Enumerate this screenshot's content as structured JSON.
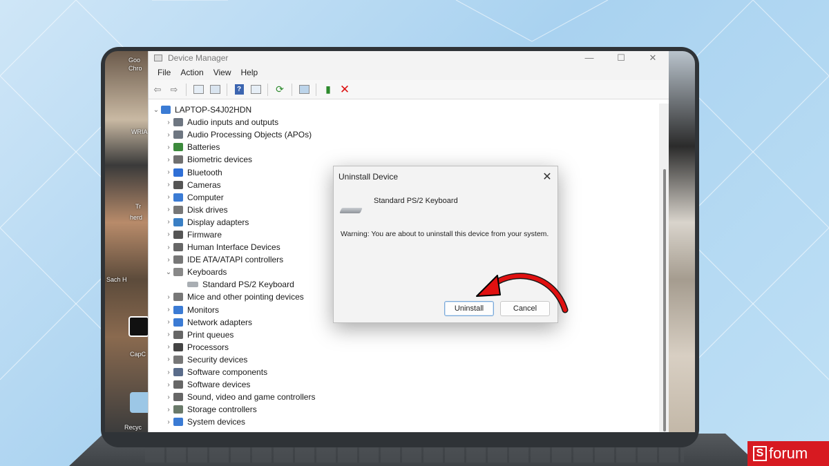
{
  "window": {
    "title": "Device Manager",
    "minimize": "—",
    "maximize": "☐",
    "close": "✕"
  },
  "menu": [
    "File",
    "Action",
    "View",
    "Help"
  ],
  "tree": {
    "root": "LAPTOP-S4J02HDN",
    "items": [
      {
        "label": "Audio inputs and outputs",
        "expanded": false
      },
      {
        "label": "Audio Processing Objects (APOs)",
        "expanded": false
      },
      {
        "label": "Batteries",
        "expanded": false
      },
      {
        "label": "Biometric devices",
        "expanded": false
      },
      {
        "label": "Bluetooth",
        "expanded": false
      },
      {
        "label": "Cameras",
        "expanded": false
      },
      {
        "label": "Computer",
        "expanded": false
      },
      {
        "label": "Disk drives",
        "expanded": false
      },
      {
        "label": "Display adapters",
        "expanded": false
      },
      {
        "label": "Firmware",
        "expanded": false
      },
      {
        "label": "Human Interface Devices",
        "expanded": false
      },
      {
        "label": "IDE ATA/ATAPI controllers",
        "expanded": false
      },
      {
        "label": "Keyboards",
        "expanded": true
      },
      {
        "label": "Standard PS/2 Keyboard",
        "child": true
      },
      {
        "label": "Mice and other pointing devices",
        "expanded": false
      },
      {
        "label": "Monitors",
        "expanded": false
      },
      {
        "label": "Network adapters",
        "expanded": false
      },
      {
        "label": "Print queues",
        "expanded": false
      },
      {
        "label": "Processors",
        "expanded": false
      },
      {
        "label": "Security devices",
        "expanded": false
      },
      {
        "label": "Software components",
        "expanded": false
      },
      {
        "label": "Software devices",
        "expanded": false
      },
      {
        "label": "Sound, video and game controllers",
        "expanded": false
      },
      {
        "label": "Storage controllers",
        "expanded": false
      },
      {
        "label": "System devices",
        "expanded": false
      }
    ]
  },
  "dialog": {
    "title": "Uninstall Device",
    "close": "✕",
    "device_name": "Standard PS/2 Keyboard",
    "warning": "Warning: You are about to uninstall this device from your system.",
    "uninstall_label": "Uninstall",
    "cancel_label": "Cancel"
  },
  "desktop": {
    "labels": [
      "Goo",
      "Chro",
      "WRIA",
      "Tr",
      "herd",
      "Sach H",
      "CapC",
      "Recyc"
    ]
  },
  "brand": {
    "logo_letter": "S",
    "logo_text": "forum"
  },
  "colors": {
    "accent_red": "#d71a21",
    "arrow_red": "#e01010",
    "delete_red": "#dd1111",
    "bezel": "#2f3337"
  }
}
